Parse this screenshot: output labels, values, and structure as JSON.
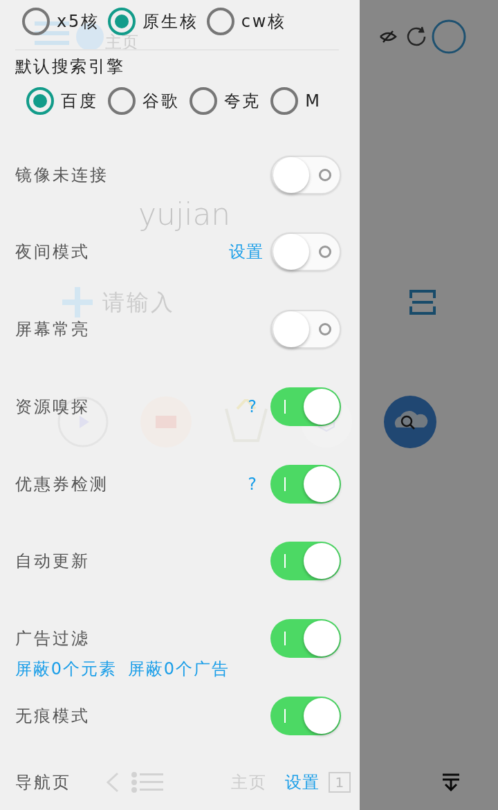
{
  "background_page": {
    "tab_label": "主页",
    "logo": "yujian",
    "search_placeholder": "请输入",
    "bottom_tab": "主页",
    "tab_count": "1"
  },
  "browser_core": [
    {
      "label": "x5核",
      "selected": false
    },
    {
      "label": "原生核",
      "selected": true
    },
    {
      "label": "cw核",
      "selected": false
    }
  ],
  "search_engine": {
    "title": "默认搜索引擎",
    "options": [
      {
        "label": "百度",
        "selected": true
      },
      {
        "label": "谷歌",
        "selected": false
      },
      {
        "label": "夸克",
        "selected": false
      },
      {
        "label": "M",
        "selected": false
      }
    ]
  },
  "settings": [
    {
      "label": "镜像未连接",
      "on": false
    },
    {
      "label": "夜间模式",
      "on": false,
      "extra": {
        "kind": "link",
        "text": "设置"
      }
    },
    {
      "label": "屏幕常亮",
      "on": false
    },
    {
      "label": "资源嗅探",
      "on": true,
      "extra": {
        "kind": "help",
        "text": "?"
      }
    },
    {
      "label": "优惠券检测",
      "on": true,
      "extra": {
        "kind": "help",
        "text": "?"
      }
    },
    {
      "label": "自动更新",
      "on": true
    },
    {
      "label": "广告过滤",
      "on": true,
      "sub_links": [
        "屏蔽0个元素",
        "屏蔽0个广告"
      ]
    },
    {
      "label": "无痕模式",
      "on": true
    }
  ],
  "nav_row": {
    "label": "导航页",
    "link": "设置"
  }
}
